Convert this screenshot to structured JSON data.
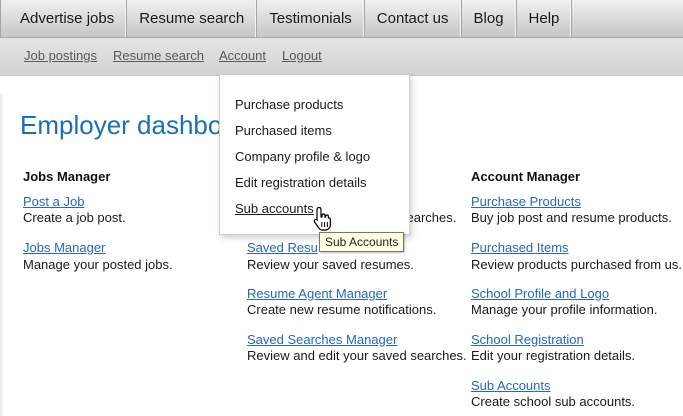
{
  "top_nav": {
    "items": [
      "Advertise jobs",
      "Resume search",
      "Testimonials",
      "Contact us",
      "Blog",
      "Help"
    ]
  },
  "sub_nav": {
    "items": [
      "Job postings",
      "Resume search",
      "Account",
      "Logout"
    ]
  },
  "page_title": "Employer dashbo",
  "jobs_manager": {
    "heading": "Jobs Manager",
    "items": [
      {
        "link": "Post a Job",
        "desc": "Create a job post."
      },
      {
        "link": "Jobs Manager",
        "desc": "Manage your posted jobs."
      }
    ]
  },
  "resume_manager": {
    "partial_desc": "searches.",
    "items": [
      {
        "link": "Saved Resu",
        "desc": "Review your saved resumes."
      },
      {
        "link": "Resume Agent Manager",
        "desc": "Create new resume notifications."
      },
      {
        "link": "Saved Searches Manager ",
        "desc": "Review and edit your saved searches."
      }
    ]
  },
  "account_manager": {
    "heading": "Account Manager",
    "items": [
      {
        "link": "Purchase Products",
        "desc": "Buy job post and resume products."
      },
      {
        "link": "Purchased Items",
        "desc": "Review products purchased from us."
      },
      {
        "link": "School Profile and Logo",
        "desc": "Manage your profile information."
      },
      {
        "link": "School Registration",
        "desc": "Edit your registration details."
      },
      {
        "link": "Sub Accounts",
        "desc": "Create school sub accounts."
      }
    ]
  },
  "account_dropdown": {
    "items": [
      "Purchase products",
      "Purchased items",
      "Company profile & logo",
      "Edit registration details",
      "Sub accounts"
    ],
    "hovered_index": 4
  },
  "tooltip": "Sub Accounts",
  "colors": {
    "link": "#2a67b1",
    "title": "#1b6fb5",
    "tooltip_bg": "#ffffe1"
  }
}
